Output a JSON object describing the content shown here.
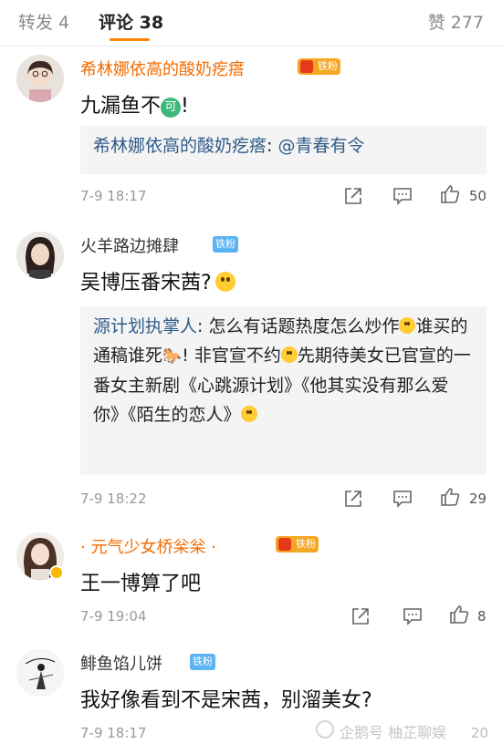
{
  "tabs": {
    "repost": "转发 4",
    "comments": "评论 38",
    "likes": "赞 277"
  },
  "colors": {
    "accent": "#ff8200",
    "fan_badge": "#5ab3f2",
    "link": "#2f5b8a"
  },
  "comments": [
    {
      "username": "希林娜依高的酸奶疙瘩",
      "fan_badge": "铁粉",
      "text_before_emoji": "九漏鱼不",
      "emoji": "可",
      "text_after_emoji": "!",
      "reply": {
        "name": "希林娜依高的酸奶疙瘩",
        "sep": ": ",
        "text": "@青春有令"
      },
      "time": "7-9 18:17",
      "likes": "50"
    },
    {
      "username": "火羊路边摊肆",
      "fan_badge": "铁粉",
      "text": "吴博压番宋茜?",
      "reply": {
        "name": "源计划执掌人",
        "sep": ": ",
        "part1": "怎么有话题热度怎么炒作",
        "part2": "谁买的通稿谁死",
        "part3": "! 非官宣不约",
        "part4": "先期待美女已官宣的一番女主新剧《心跳源计划》《他其实没有那么爱你》《陌生的恋人》"
      },
      "time": "7-9 18:22",
      "likes": "29"
    },
    {
      "username": "· 元气少女桥枀枀 ·",
      "fan_badge": "铁粉",
      "text": "王一博算了吧",
      "time": "7-9 19:04",
      "likes": "8"
    },
    {
      "username": "鲱鱼馅儿饼",
      "fan_badge": "铁粉",
      "text": "我好像看到不是宋茜，别溜美女?",
      "time": "7-9 18:17",
      "likes": "20"
    }
  ],
  "watermark": "企鹅号 柚芷聊娱"
}
